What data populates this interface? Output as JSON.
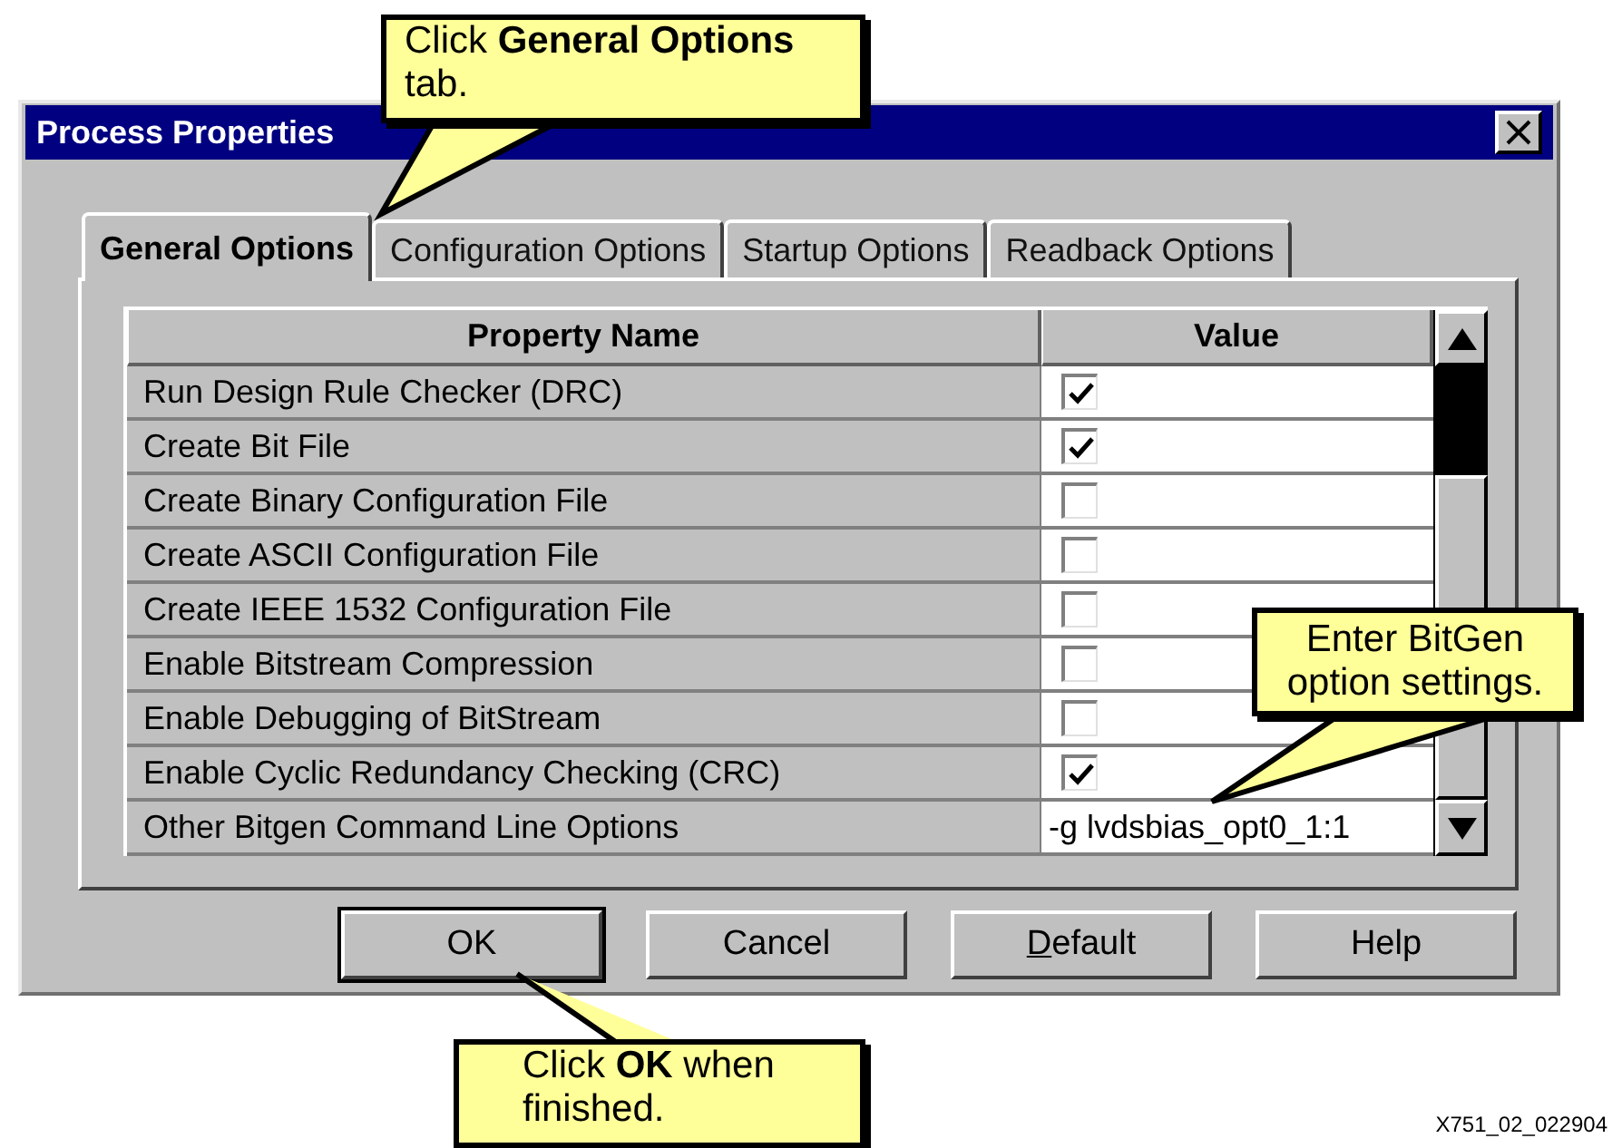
{
  "window": {
    "title": "Process Properties"
  },
  "tabs": [
    {
      "label": "General Options",
      "selected": true
    },
    {
      "label": "Configuration Options",
      "selected": false
    },
    {
      "label": "Startup Options",
      "selected": false
    },
    {
      "label": "Readback Options",
      "selected": false
    }
  ],
  "table": {
    "columns": [
      "Property Name",
      "Value"
    ],
    "rows": [
      {
        "name": "Run Design Rule Checker (DRC)",
        "kind": "checkbox",
        "checked": true
      },
      {
        "name": "Create Bit File",
        "kind": "checkbox",
        "checked": true
      },
      {
        "name": "Create Binary Configuration File",
        "kind": "checkbox",
        "checked": false
      },
      {
        "name": "Create ASCII Configuration File",
        "kind": "checkbox",
        "checked": false
      },
      {
        "name": "Create IEEE 1532 Configuration File",
        "kind": "checkbox",
        "checked": false
      },
      {
        "name": "Enable Bitstream Compression",
        "kind": "checkbox",
        "checked": false
      },
      {
        "name": "Enable Debugging of BitStream",
        "kind": "checkbox",
        "checked": false
      },
      {
        "name": "Enable Cyclic Redundancy Checking (CRC)",
        "kind": "checkbox",
        "checked": true
      },
      {
        "name": "Other Bitgen Command Line Options",
        "kind": "text",
        "value": "-g lvdsbias_opt0_1:1"
      }
    ]
  },
  "buttons": [
    {
      "label": "OK",
      "default": true,
      "mnemonic": false
    },
    {
      "label": "Cancel",
      "default": false,
      "mnemonic": false
    },
    {
      "label": "Default",
      "default": false,
      "mnemonic": true
    },
    {
      "label": "Help",
      "default": false,
      "mnemonic": false
    }
  ],
  "callouts": [
    {
      "text": "Click **General Options** tab."
    },
    {
      "text": "Enter BitGen option settings."
    },
    {
      "text": "Click **OK** when finished."
    }
  ],
  "figure_id": "X751_02_022904"
}
